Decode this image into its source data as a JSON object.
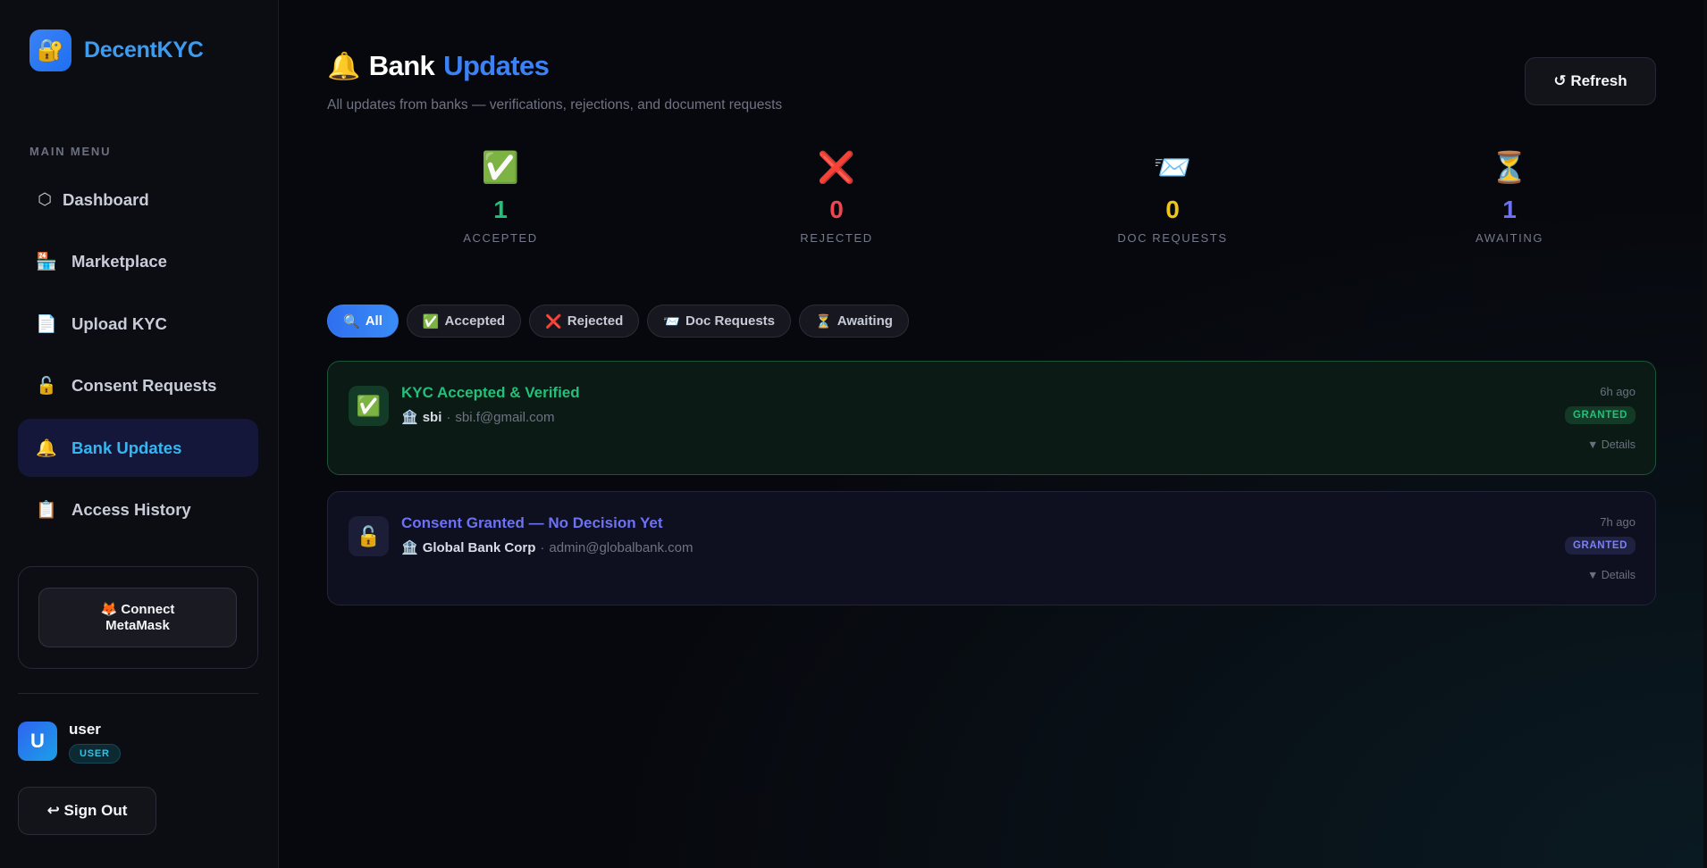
{
  "app": {
    "name": "DecentKYC",
    "logo_icon": "🔐"
  },
  "sidebar": {
    "menu_label": "MAIN MENU",
    "items": [
      {
        "icon": "⬡",
        "label": "Dashboard",
        "active": false
      },
      {
        "icon": "🏪",
        "label": "Marketplace",
        "active": false
      },
      {
        "icon": "📄",
        "label": "Upload KYC",
        "active": false
      },
      {
        "icon": "🔓",
        "label": "Consent Requests",
        "active": false
      },
      {
        "icon": "🔔",
        "label": "Bank Updates",
        "active": true
      },
      {
        "icon": "📋",
        "label": "Access History",
        "active": false
      }
    ],
    "wallet_button": "🦊 Connect MetaMask",
    "user": {
      "avatar_letter": "U",
      "name": "user",
      "role": "USER"
    },
    "signout": "↩ Sign Out"
  },
  "header": {
    "title_icon": "🔔",
    "title_part1": "Bank",
    "title_part2": "Updates",
    "subtitle": "All updates from banks — verifications, rejections, and document requests",
    "refresh": "↺ Refresh"
  },
  "stats": [
    {
      "icon": "✅",
      "value": "1",
      "label": "ACCEPTED",
      "color": "#22c07a"
    },
    {
      "icon": "❌",
      "value": "0",
      "label": "REJECTED",
      "color": "#ef4452"
    },
    {
      "icon": "📨",
      "value": "0",
      "label": "DOC REQUESTS",
      "color": "#f0c419"
    },
    {
      "icon": "⏳",
      "value": "1",
      "label": "AWAITING",
      "color": "#6d72f4"
    }
  ],
  "filters": [
    {
      "icon": "🔍",
      "label": "All",
      "active": true
    },
    {
      "icon": "✅",
      "label": "Accepted",
      "active": false
    },
    {
      "icon": "❌",
      "label": "Rejected",
      "active": false
    },
    {
      "icon": "📨",
      "label": "Doc Requests",
      "active": false
    },
    {
      "icon": "⏳",
      "label": "Awaiting",
      "active": false
    }
  ],
  "updates": [
    {
      "icon": "✅",
      "title": "KYC Accepted & Verified",
      "bank_icon": "🏦",
      "bank": "sbi",
      "email": "sbi.f@gmail.com",
      "time": "6h ago",
      "status": "GRANTED",
      "details": "▼ Details"
    },
    {
      "icon": "🔓",
      "title": "Consent Granted — No Decision Yet",
      "bank_icon": "🏦",
      "bank": "Global Bank Corp",
      "email": "admin@globalbank.com",
      "time": "7h ago",
      "status": "GRANTED",
      "details": "▼ Details"
    }
  ]
}
